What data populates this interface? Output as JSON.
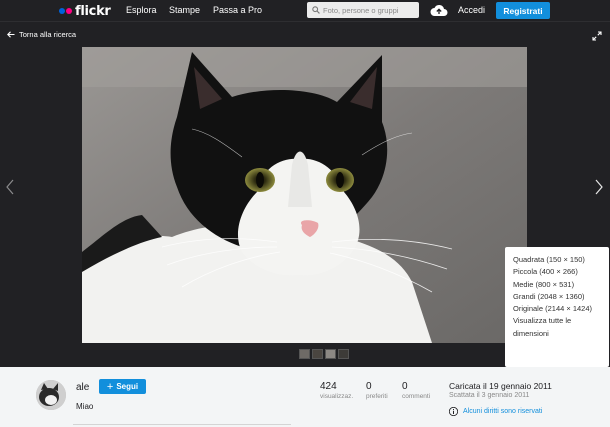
{
  "header": {
    "logo": "flickr",
    "nav": [
      "Esplora",
      "Stampe",
      "Passa a Pro"
    ],
    "search_placeholder": "Foto, persone o gruppi",
    "signin": "Accedi",
    "register": "Registrati"
  },
  "viewer": {
    "back_label": "Torna alla ricerca"
  },
  "download_menu": {
    "items": [
      "Quadrata (150 × 150)",
      "Piccola (400 × 266)",
      "Medie (800 × 531)",
      "Grandi (2048 × 1360)",
      "Originale (2144 × 1424)",
      "Visualizza tutte le dimensioni"
    ]
  },
  "owner": {
    "name": "ale",
    "follow_label": "Segui"
  },
  "photo": {
    "title": "Miao"
  },
  "stats": [
    {
      "value": "424",
      "label": "visualizzaz."
    },
    {
      "value": "0",
      "label": "preferiti"
    },
    {
      "value": "0",
      "label": "commenti"
    }
  ],
  "dates": {
    "uploaded": "Caricata il 19 gennaio 2011",
    "taken": "Scattata il 3 gennaio 2011"
  },
  "license": "Alcuni diritti sono riservati",
  "colors": {
    "accent": "#128fdc",
    "dark_bg": "#212124",
    "logo_blue": "#0063dc",
    "logo_pink": "#ff0084"
  }
}
